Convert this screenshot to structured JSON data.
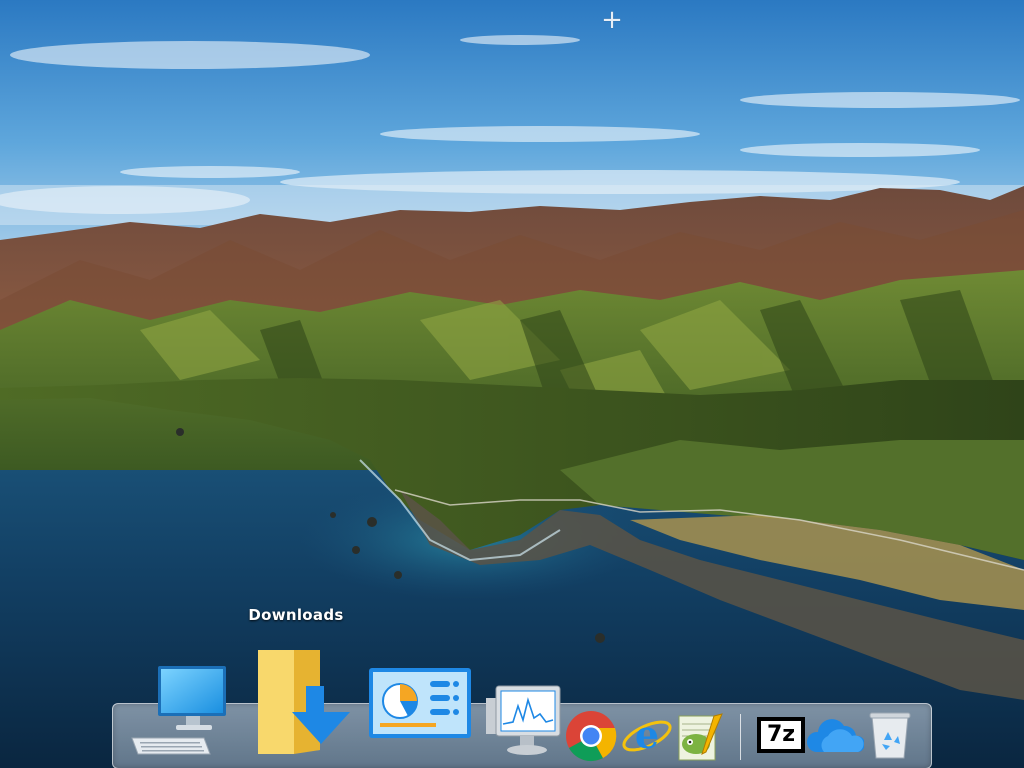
{
  "desktop": {
    "wallpaper": "coastal-mountains-landscape",
    "cursor_glyph": "+"
  },
  "dock": {
    "tooltip": "Downloads",
    "items": [
      {
        "name": "This PC",
        "icon": "computer-icon"
      },
      {
        "name": "Downloads",
        "icon": "downloads-folder-icon"
      },
      {
        "name": "Control Panel",
        "icon": "control-panel-icon"
      },
      {
        "name": "Performance Monitor",
        "icon": "performance-monitor-icon"
      },
      {
        "name": "Google Chrome",
        "icon": "chrome-icon"
      },
      {
        "name": "Internet Explorer",
        "icon": "internet-explorer-icon"
      },
      {
        "name": "Notepad++",
        "icon": "notepad-plus-plus-icon"
      },
      {
        "name": "7-Zip",
        "icon": "7zip-icon",
        "label": "7z"
      },
      {
        "name": "OneDrive",
        "icon": "onedrive-icon"
      },
      {
        "name": "Recycle Bin",
        "icon": "recycle-bin-icon"
      }
    ]
  },
  "colors": {
    "sky_top": "#2e7ec4",
    "sea": "#10385a",
    "folder": "#f5c842",
    "accent_blue": "#1e88e5"
  }
}
